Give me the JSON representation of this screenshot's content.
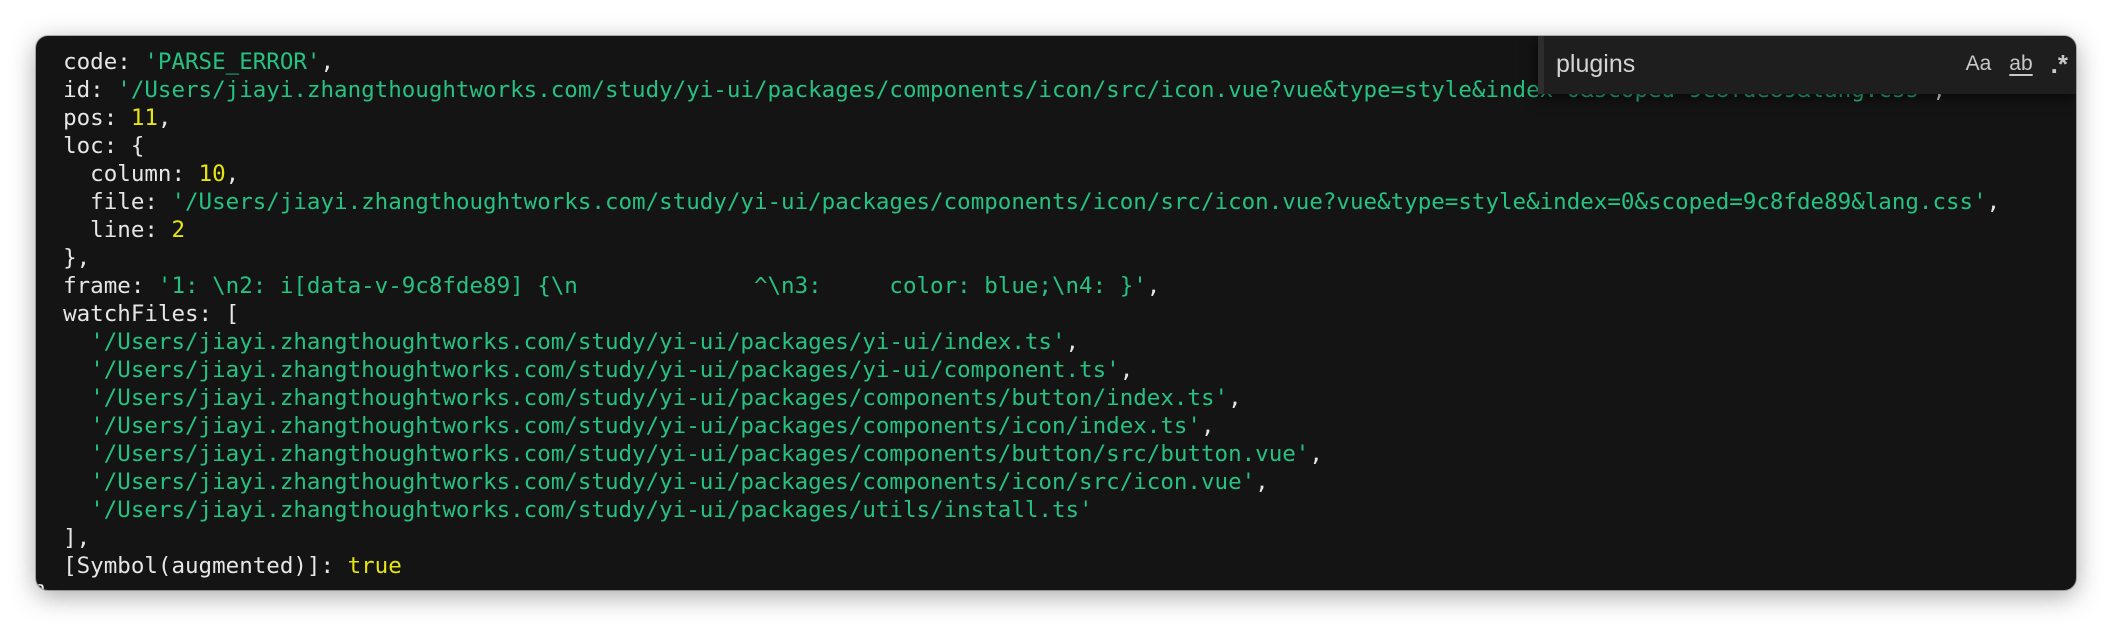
{
  "terminal": {
    "lines": [
      "  code: 'PARSE_ERROR',",
      "  id: '/Users/jiayi.zhangthoughtworks.com/study/yi-ui/packages/components/icon/src/icon.vue?vue&type=style&index=0&scoped=9c8fde89&lang.css',",
      "  pos: 11,",
      "  loc: {",
      "    column: 10,",
      "    file: '/Users/jiayi.zhangthoughtworks.com/study/yi-ui/packages/components/icon/src/icon.vue?vue&type=style&index=0&scoped=9c8fde89&lang.css',",
      "    line: 2",
      "  },",
      "  frame: '1: \\n2: i[data-v-9c8fde89] {\\n             ^\\n3:     color: blue;\\n4: }',",
      "  watchFiles: [",
      "    '/Users/jiayi.zhangthoughtworks.com/study/yi-ui/packages/yi-ui/index.ts',",
      "    '/Users/jiayi.zhangthoughtworks.com/study/yi-ui/packages/yi-ui/component.ts',",
      "    '/Users/jiayi.zhangthoughtworks.com/study/yi-ui/packages/components/button/index.ts',",
      "    '/Users/jiayi.zhangthoughtworks.com/study/yi-ui/packages/components/icon/index.ts',",
      "    '/Users/jiayi.zhangthoughtworks.com/study/yi-ui/packages/components/button/src/button.vue',",
      "    '/Users/jiayi.zhangthoughtworks.com/study/yi-ui/packages/components/icon/src/icon.vue',",
      "    '/Users/jiayi.zhangthoughtworks.com/study/yi-ui/packages/utils/install.ts'",
      "  ],",
      "  [Symbol(augmented)]: true",
      "}"
    ]
  },
  "find_widget": {
    "query": "plugins",
    "match_case_label": "Aa",
    "whole_word_label": "ab",
    "regex_label": ".*"
  },
  "colors": {
    "background": "#141414",
    "default_text": "#e6e6e6",
    "string": "#26c281",
    "number": "#e5e510"
  }
}
